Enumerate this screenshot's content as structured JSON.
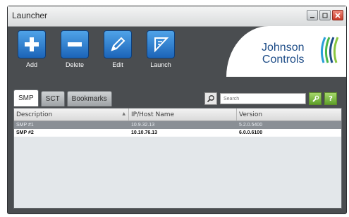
{
  "window": {
    "title": "Launcher"
  },
  "toolbar": {
    "items": [
      {
        "label": "Add",
        "icon": "plus-icon"
      },
      {
        "label": "Delete",
        "icon": "minus-icon"
      },
      {
        "label": "Edit",
        "icon": "pencil-icon"
      },
      {
        "label": "Launch",
        "icon": "launch-icon"
      }
    ]
  },
  "brand": {
    "line1": "Johnson",
    "line2": "Controls"
  },
  "tabs": [
    {
      "label": "SMP",
      "active": true
    },
    {
      "label": "SCT",
      "active": false
    },
    {
      "label": "Bookmarks",
      "active": false
    }
  ],
  "search": {
    "placeholder": "Search"
  },
  "table": {
    "columns": [
      "Description",
      "IP/Host Name",
      "Version"
    ],
    "rows": [
      [
        "SMP #1",
        "10.9.32.13",
        "5.2.0.5400"
      ],
      [
        "SMP #2",
        "10.10.76.13",
        "6.0.0.6100"
      ]
    ]
  },
  "colors": {
    "window_bg": "#4a4d50",
    "button_blue": "#1c64b8",
    "brand_blue": "#1d4c87",
    "selected_row": "#8a8f95"
  }
}
